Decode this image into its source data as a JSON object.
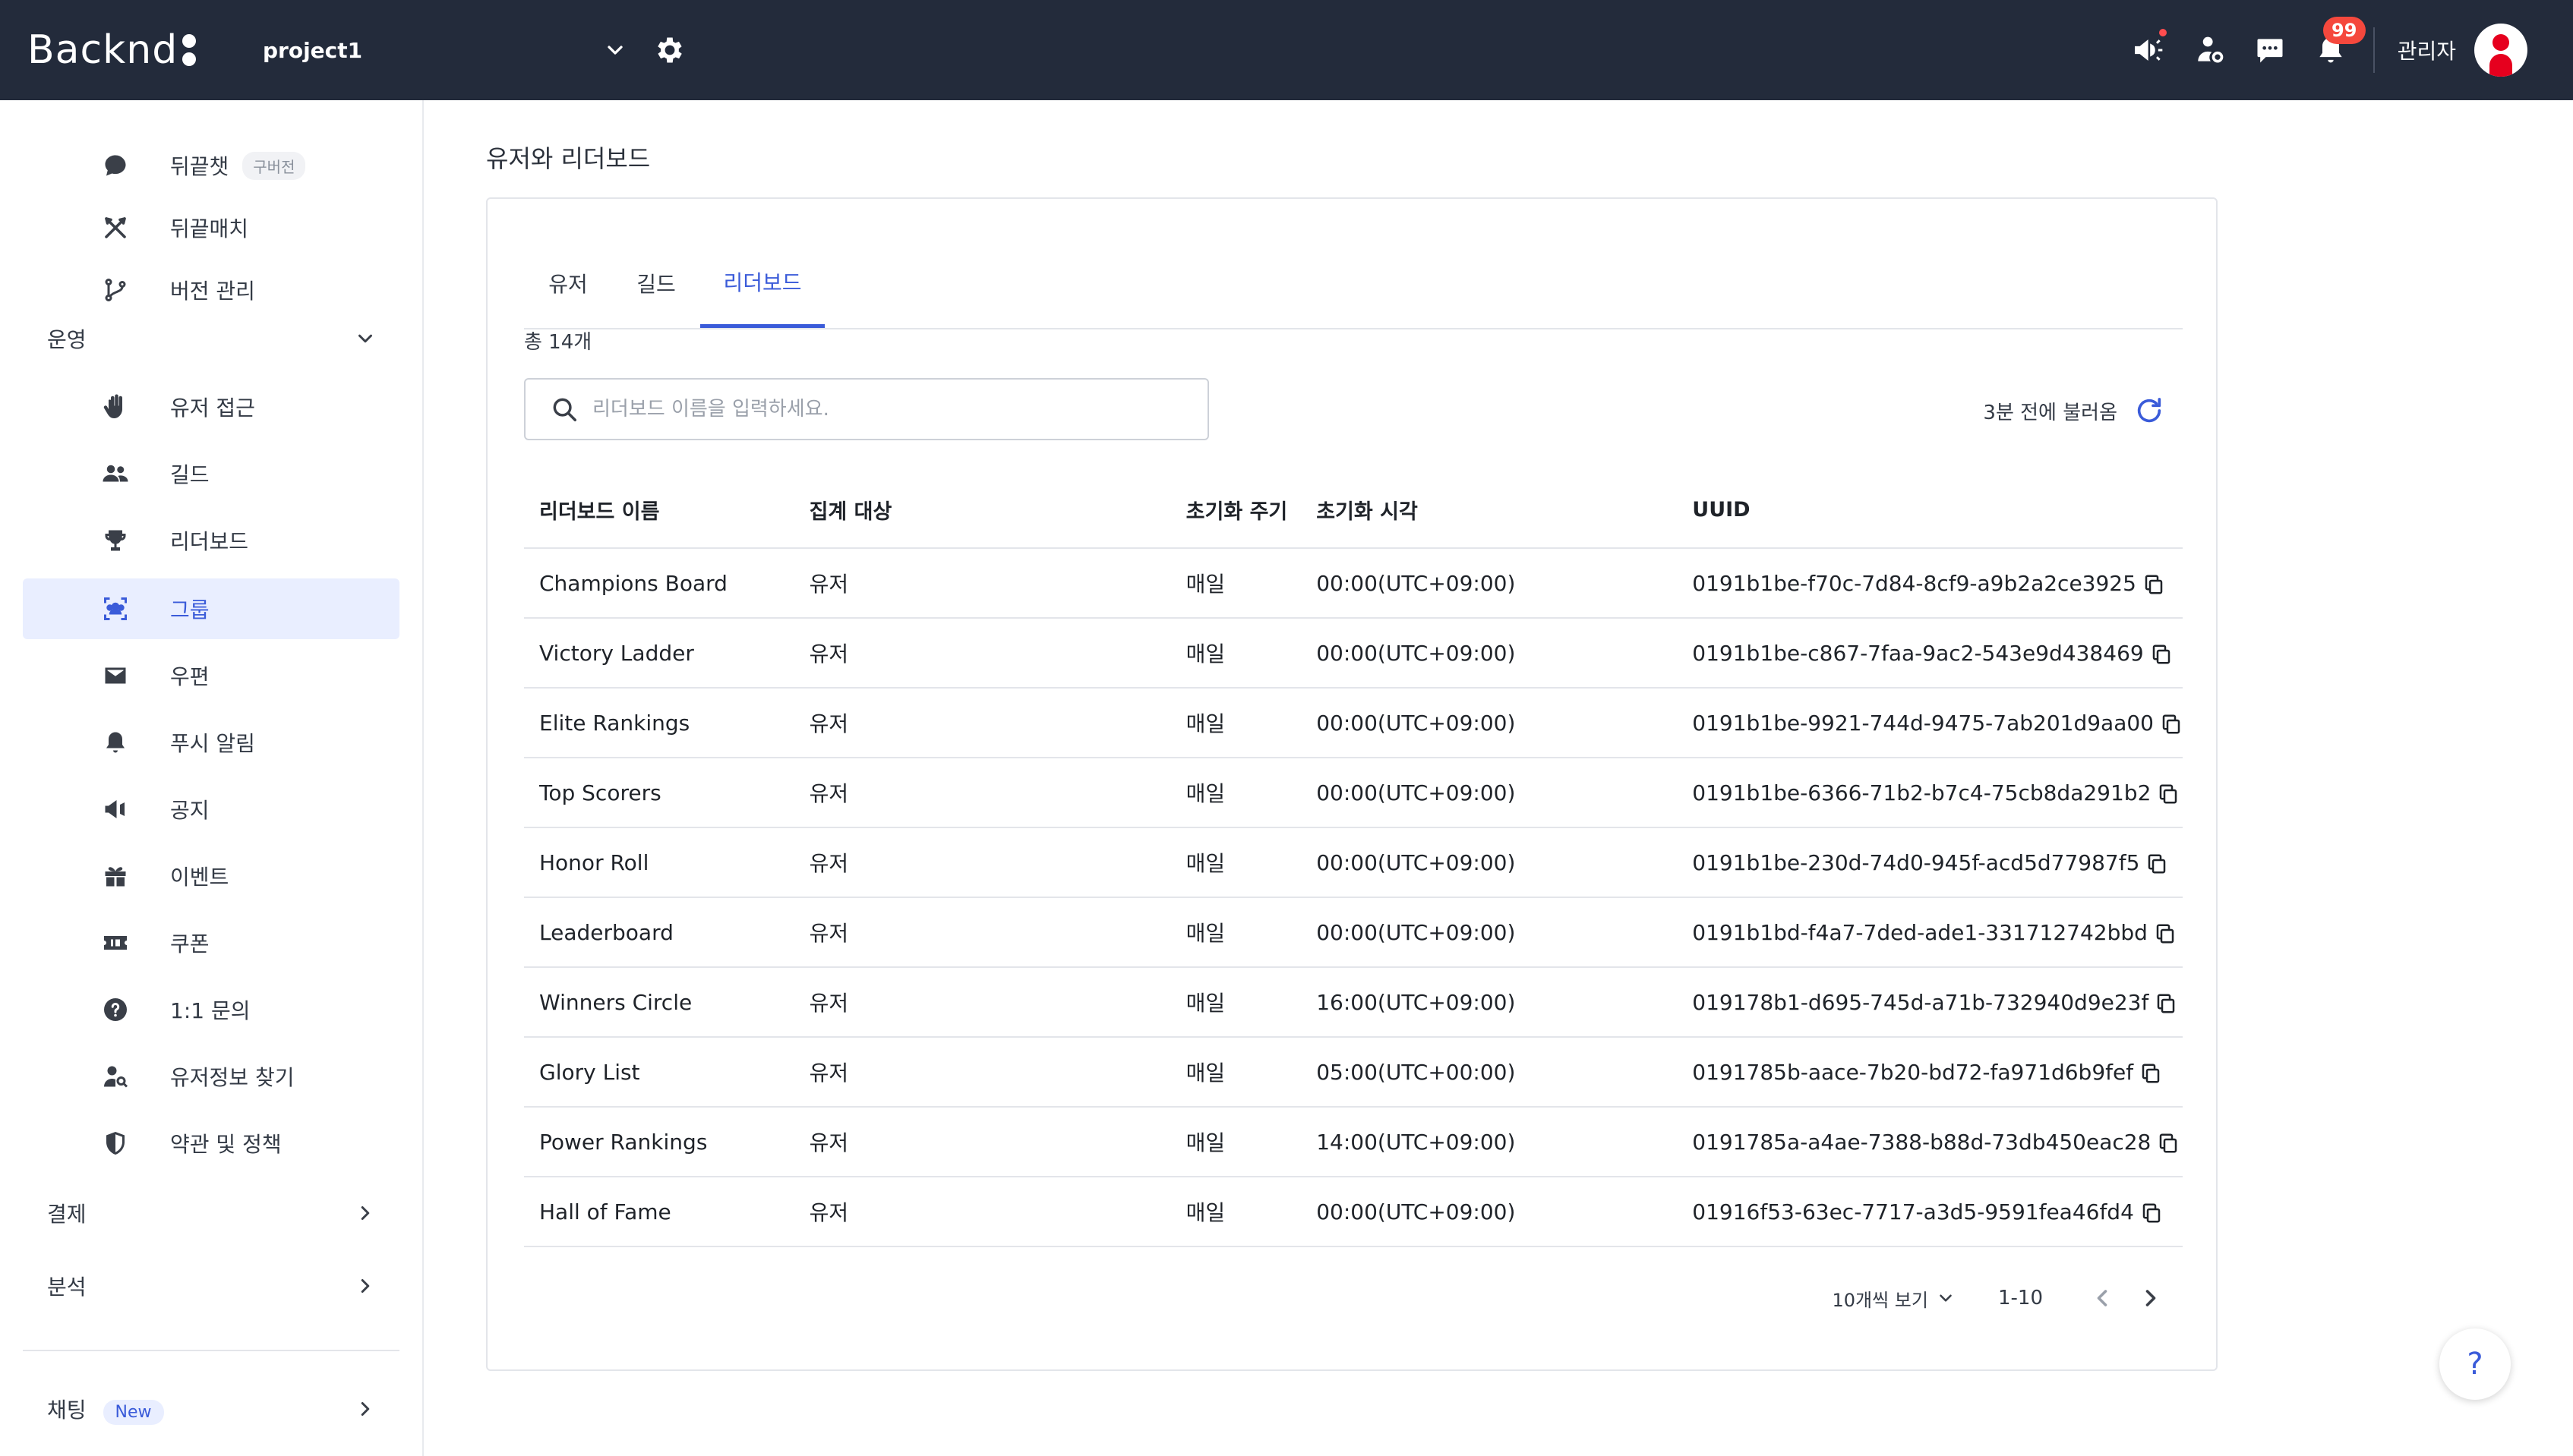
{
  "header": {
    "logo": "Backnd",
    "project": "project1",
    "notification_count": "99",
    "admin_name": "관리자"
  },
  "sidebar": {
    "items": [
      {
        "label": "뒤끝챗",
        "tag": "구버전",
        "icon": "chat-icon"
      },
      {
        "label": "뒤끝매치",
        "icon": "crossed-swords-icon"
      },
      {
        "label": "버전 관리",
        "icon": "branch-icon"
      }
    ],
    "groups": {
      "operations": "운영",
      "payment": "결제",
      "analytics": "분석",
      "chatting": "채팅",
      "chatting_tag": "New"
    },
    "operation_items": [
      {
        "label": "유저 접근",
        "icon": "hand-icon"
      },
      {
        "label": "길드",
        "icon": "people-icon"
      },
      {
        "label": "리더보드",
        "icon": "trophy-icon"
      },
      {
        "label": "그룹",
        "icon": "group-icon",
        "active": true
      },
      {
        "label": "우편",
        "icon": "mail-icon"
      },
      {
        "label": "푸시 알림",
        "icon": "bell-icon"
      },
      {
        "label": "공지",
        "icon": "megaphone-icon"
      },
      {
        "label": "이벤트",
        "icon": "gift-icon"
      },
      {
        "label": "쿠폰",
        "icon": "ticket-icon"
      },
      {
        "label": "1:1 문의",
        "icon": "question-icon"
      },
      {
        "label": "유저정보 찾기",
        "icon": "user-search-icon"
      },
      {
        "label": "약관 및 정책",
        "icon": "shield-icon"
      }
    ]
  },
  "main": {
    "page_title": "유저와 리더보드",
    "tabs": [
      {
        "label": "유저"
      },
      {
        "label": "길드"
      },
      {
        "label": "리더보드",
        "active": true
      }
    ],
    "total": "총 14개",
    "search_placeholder": "리더보드 이름을 입력하세요.",
    "refreshed": "3분 전에 불러옴",
    "columns": [
      "리더보드 이름",
      "집계 대상",
      "초기화 주기",
      "초기화 시각",
      "UUID"
    ],
    "rows": [
      [
        "Champions Board",
        "유저",
        "매일",
        "00:00(UTC+09:00)",
        "0191b1be-f70c-7d84-8cf9-a9b2a2ce3925"
      ],
      [
        "Victory Ladder",
        "유저",
        "매일",
        "00:00(UTC+09:00)",
        "0191b1be-c867-7faa-9ac2-543e9d438469"
      ],
      [
        "Elite Rankings",
        "유저",
        "매일",
        "00:00(UTC+09:00)",
        "0191b1be-9921-744d-9475-7ab201d9aa00"
      ],
      [
        "Top Scorers",
        "유저",
        "매일",
        "00:00(UTC+09:00)",
        "0191b1be-6366-71b2-b7c4-75cb8da291b2"
      ],
      [
        "Honor Roll",
        "유저",
        "매일",
        "00:00(UTC+09:00)",
        "0191b1be-230d-74d0-945f-acd5d77987f5"
      ],
      [
        "Leaderboard",
        "유저",
        "매일",
        "00:00(UTC+09:00)",
        "0191b1bd-f4a7-7ded-ade1-331712742bbd"
      ],
      [
        "Winners Circle",
        "유저",
        "매일",
        "16:00(UTC+09:00)",
        "019178b1-d695-745d-a71b-732940d9e23f"
      ],
      [
        "Glory List",
        "유저",
        "매일",
        "05:00(UTC+00:00)",
        "0191785b-aace-7b20-bd72-fa971d6b9fef"
      ],
      [
        "Power Rankings",
        "유저",
        "매일",
        "14:00(UTC+09:00)",
        "0191785a-a4ae-7388-b88d-73db450eac28"
      ],
      [
        "Hall of Fame",
        "유저",
        "매일",
        "00:00(UTC+09:00)",
        "01916f53-63ec-7717-a3d5-9591fea46fd4"
      ]
    ],
    "pagination": {
      "page_size": "10개씩 보기",
      "range": "1-10"
    }
  },
  "help": "?",
  "colors": {
    "topbar": "#232b3b",
    "accent": "#3a5bd9",
    "active_bg": "#e9eeff",
    "badge": "#f5483d"
  }
}
